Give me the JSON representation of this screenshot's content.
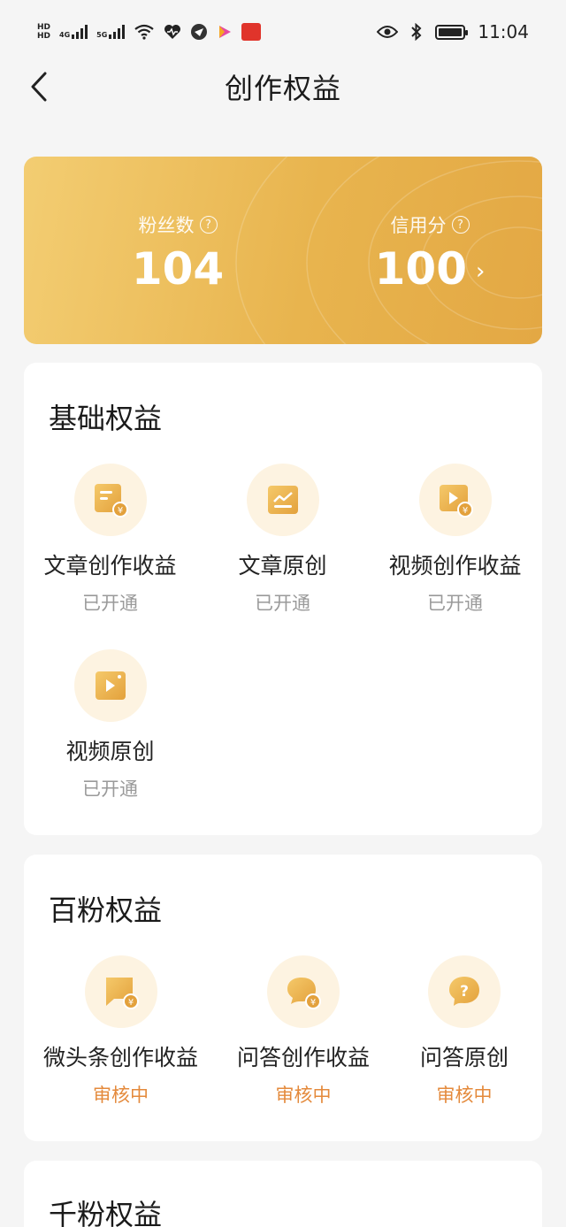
{
  "status_bar": {
    "time": "11:04",
    "net_4g": "4G",
    "net_5g": "5G",
    "hd1": "HD",
    "hd2": "HD"
  },
  "nav": {
    "title": "创作权益"
  },
  "stats": {
    "fans_label": "粉丝数",
    "fans_value": "104",
    "credit_label": "信用分",
    "credit_value": "100"
  },
  "sections": {
    "basic": {
      "title": "基础权益",
      "items": [
        {
          "label": "文章创作收益",
          "status": "已开通",
          "icon": "article-income-icon"
        },
        {
          "label": "文章原创",
          "status": "已开通",
          "icon": "article-original-icon"
        },
        {
          "label": "视频创作收益",
          "status": "已开通",
          "icon": "video-income-icon"
        },
        {
          "label": "视频原创",
          "status": "已开通",
          "icon": "video-original-icon"
        }
      ]
    },
    "hundred": {
      "title": "百粉权益",
      "items": [
        {
          "label": "微头条创作收益",
          "status": "审核中",
          "icon": "micro-post-income-icon"
        },
        {
          "label": "问答创作收益",
          "status": "审核中",
          "icon": "qa-income-icon"
        },
        {
          "label": "问答原创",
          "status": "审核中",
          "icon": "qa-original-icon"
        }
      ]
    },
    "thousand": {
      "title": "千粉权益"
    }
  },
  "colors": {
    "gold_start": "#f3cd72",
    "gold_end": "#e3a844",
    "icon_bg": "#fdf3e1",
    "review_orange": "#e48a3c",
    "opened_gray": "#9a9a9a"
  }
}
